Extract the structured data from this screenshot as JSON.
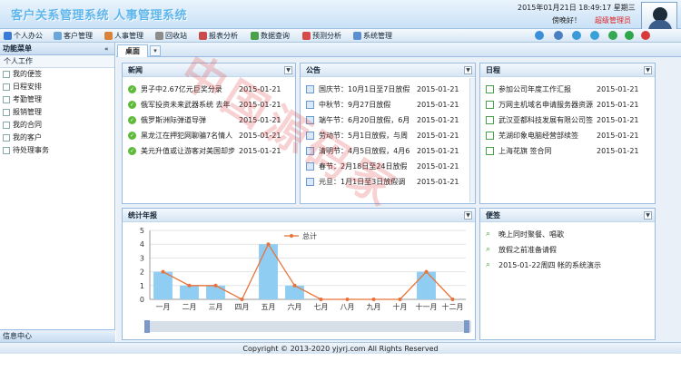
{
  "header": {
    "title": "客户关系管理系统 人事管理系统",
    "datetime": "2015年01月21日 18:49:17 星期三",
    "greeting": "傍晚好！",
    "role": "超级管理员"
  },
  "menu": [
    {
      "label": "个人办公",
      "icon": "person-icon",
      "color": "#3a7bd5"
    },
    {
      "label": "客户管理",
      "icon": "customer-icon",
      "color": "#6aa6d8"
    },
    {
      "label": "人事管理",
      "icon": "hr-icon",
      "color": "#d8823a"
    },
    {
      "label": "回收站",
      "icon": "recycle-icon",
      "color": "#8c8c8c"
    },
    {
      "label": "报表分析",
      "icon": "report-icon",
      "color": "#c94a4a"
    },
    {
      "label": "数据查询",
      "icon": "query-icon",
      "color": "#4aa14a"
    },
    {
      "label": "预测分析",
      "icon": "forecast-icon",
      "color": "#d84a4a"
    },
    {
      "label": "系统管理",
      "icon": "system-icon",
      "color": "#5a8fd0"
    }
  ],
  "toolbar_icons": [
    {
      "name": "home-icon",
      "color": "#3a8fd8"
    },
    {
      "name": "desktop-icon",
      "color": "#4a7fc0"
    },
    {
      "name": "settings-icon",
      "color": "#3a9ad8"
    },
    {
      "name": "help-icon",
      "color": "#3aa0d8"
    },
    {
      "name": "refresh-icon",
      "color": "#34a853"
    },
    {
      "name": "chat-icon",
      "color": "#2ea64a"
    },
    {
      "name": "logout-icon",
      "color": "#d83a3a"
    }
  ],
  "sidebar": {
    "title": "功能菜单",
    "section": "个人工作",
    "items": [
      "我的便签",
      "日程安排",
      "考勤管理",
      "报销管理",
      "我的合同",
      "我的客户",
      "待处理事务"
    ],
    "footer": "信息中心"
  },
  "tabs": [
    {
      "label": "桌面"
    }
  ],
  "news": {
    "title": "新闻",
    "items": [
      {
        "text": "男子中2.67亿元巨奖分录",
        "date": "2015-01-21"
      },
      {
        "text": "俄军投资未来武器系统 去年",
        "date": "2015-01-21"
      },
      {
        "text": "俄罗斯洲际弹道导弹",
        "date": "2015-01-21"
      },
      {
        "text": "黑龙江在押犯网聊骗7名情人",
        "date": "2015-01-21"
      },
      {
        "text": "美元升值或让游客对美国却步",
        "date": "2015-01-21"
      }
    ]
  },
  "notice": {
    "title": "公告",
    "items": [
      {
        "text": "国庆节：10月1日至7日放假",
        "date": "2015-01-21"
      },
      {
        "text": "中秋节：9月27日放假",
        "date": "2015-01-21"
      },
      {
        "text": "端午节：6月20日放假，6月",
        "date": "2015-01-21"
      },
      {
        "text": "劳动节：5月1日放假，与周",
        "date": "2015-01-21"
      },
      {
        "text": "清明节：4月5日放假，4月6",
        "date": "2015-01-21"
      },
      {
        "text": "春节：2月18日至24日放假",
        "date": "2015-01-21"
      },
      {
        "text": "元旦：1月1日至3日放假调",
        "date": "2015-01-21"
      }
    ]
  },
  "schedule": {
    "title": "日程",
    "items": [
      {
        "text": "参加公司年度工作汇报",
        "date": "2015-01-21"
      },
      {
        "text": "万网主机域名申请服务器资源",
        "date": "2015-01-21"
      },
      {
        "text": "武汉亚都科技发展有限公司签",
        "date": "2015-01-21"
      },
      {
        "text": "芜湖印象电脑经营部续签",
        "date": "2015-01-21"
      },
      {
        "text": "上海花旗 签合同",
        "date": "2015-01-21"
      }
    ]
  },
  "stats": {
    "title": "统计年报"
  },
  "memo": {
    "title": "便签",
    "items": [
      "晚上同时聚餐、唱歌",
      "放假之前准备请假",
      "2015-01-22周四 帐的系统演示"
    ]
  },
  "footer": {
    "copyright": "Copyright © 2013-2020 yjyrj.com All Rights Reserved"
  },
  "watermark": {
    "text": "中国源码家"
  },
  "chart_data": {
    "type": "bar",
    "categories": [
      "一月",
      "二月",
      "三月",
      "四月",
      "五月",
      "六月",
      "七月",
      "八月",
      "九月",
      "十月",
      "十一月",
      "十二月"
    ],
    "series": [
      {
        "name": "总计",
        "values": [
          2,
          1,
          1,
          0,
          4,
          1,
          0,
          0,
          0,
          0,
          2,
          0
        ],
        "bar_color": "#8fcdf2",
        "line_color": "#e8733a"
      }
    ],
    "yticks": [
      0,
      1,
      2,
      3,
      4,
      5
    ],
    "ylim": [
      0,
      5
    ],
    "grid": true,
    "legend": "top-center"
  }
}
